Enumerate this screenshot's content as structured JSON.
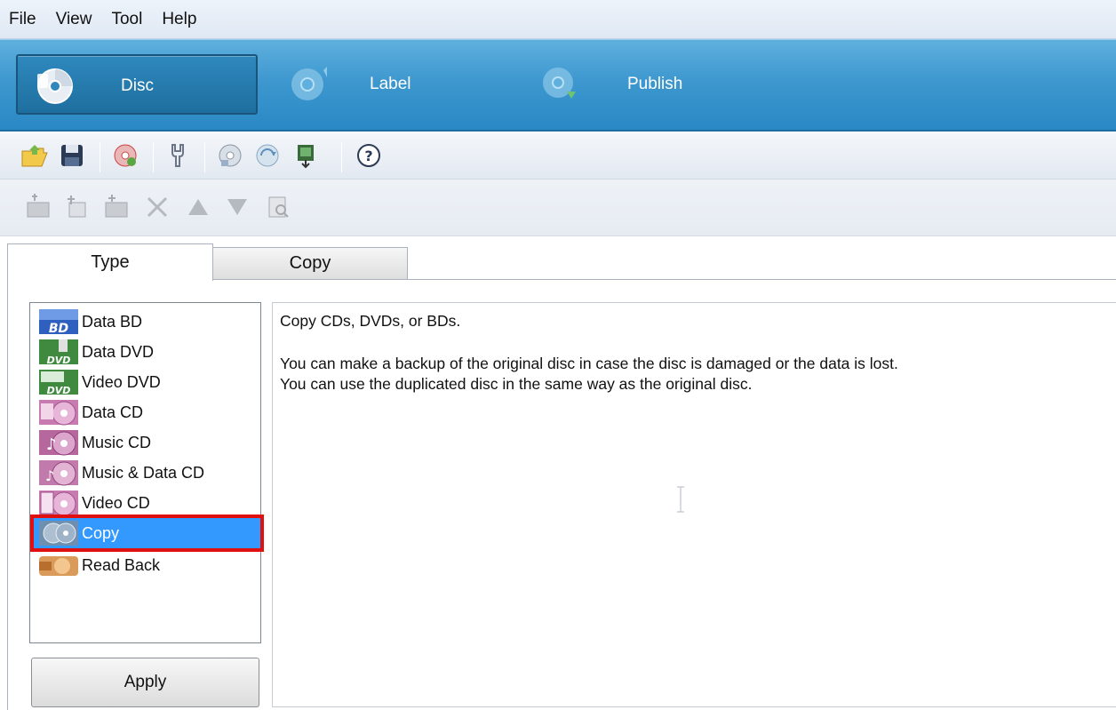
{
  "menu": {
    "items": [
      "File",
      "View",
      "Tool",
      "Help"
    ]
  },
  "modes": [
    {
      "label": "Disc",
      "active": true
    },
    {
      "label": "Label",
      "active": false
    },
    {
      "label": "Publish",
      "active": false
    }
  ],
  "toolbar1": {
    "icons": [
      "open-folder-icon",
      "save-icon",
      "burn-disc-icon",
      "settings-tools-icon",
      "disc-info-icon",
      "disc-refresh-icon",
      "export-icon",
      "help-icon"
    ]
  },
  "toolbar2": {
    "icons": [
      "add-folder-icon",
      "new-folder-icon",
      "rename-folder-icon",
      "delete-icon",
      "move-up-icon",
      "move-down-icon",
      "view-properties-icon"
    ]
  },
  "tabs": [
    {
      "label": "Type",
      "active": true
    },
    {
      "label": "Copy",
      "active": false
    }
  ],
  "disc_types": [
    {
      "label": "Data BD",
      "icon": "data-bd-icon"
    },
    {
      "label": "Data DVD",
      "icon": "data-dvd-icon"
    },
    {
      "label": "Video DVD",
      "icon": "video-dvd-icon"
    },
    {
      "label": "Data CD",
      "icon": "data-cd-icon"
    },
    {
      "label": "Music CD",
      "icon": "music-cd-icon"
    },
    {
      "label": "Music & Data CD",
      "icon": "music-data-cd-icon"
    },
    {
      "label": "Video CD",
      "icon": "video-cd-icon"
    },
    {
      "label": "Copy",
      "icon": "copy-disc-icon",
      "selected": true
    },
    {
      "label": "Read Back",
      "icon": "read-back-icon"
    }
  ],
  "description": {
    "line1": "Copy CDs, DVDs, or BDs.",
    "line2": "You can make a backup of the original disc in case the disc is damaged or the data is lost.",
    "line3": "You can use the duplicated disc in the same way as the original disc."
  },
  "apply_label": "Apply",
  "colors": {
    "accent": "#2a88c4",
    "selection": "#3399ff",
    "highlight_box": "#e01010"
  }
}
